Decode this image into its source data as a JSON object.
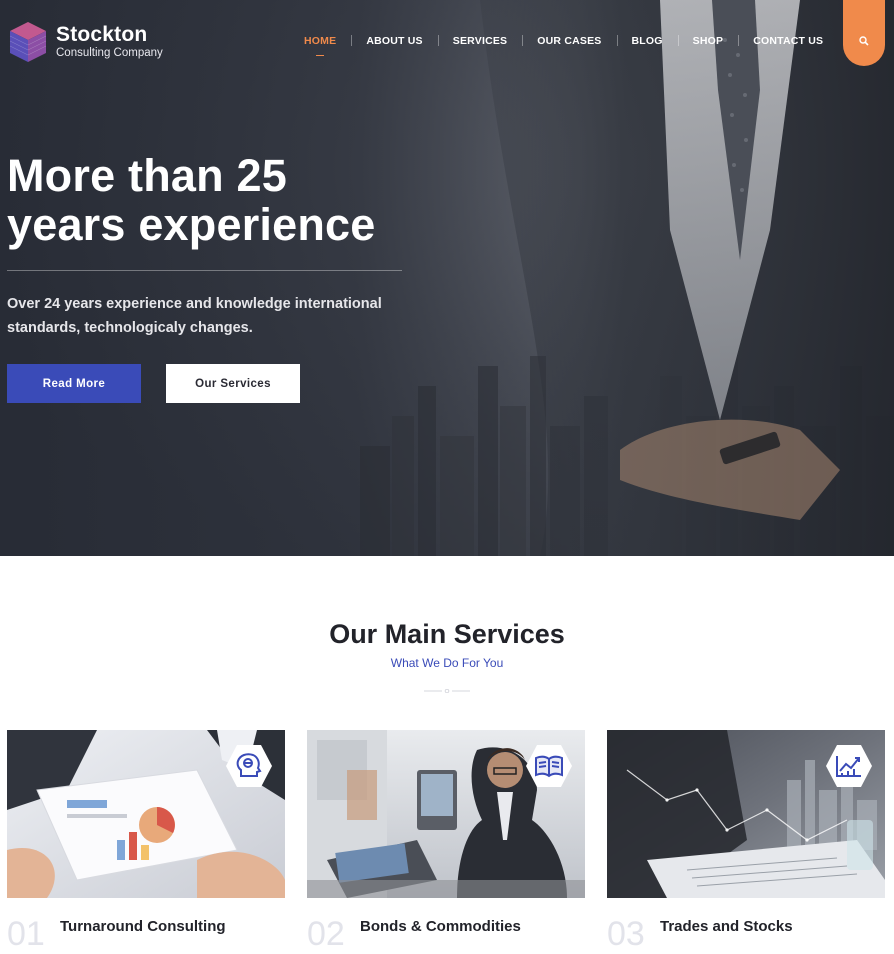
{
  "brand": {
    "name": "Stockton",
    "tagline": "Consulting Company",
    "logo_icon": "cube-logo-icon"
  },
  "nav": {
    "items": [
      {
        "label": "HOME",
        "active": true
      },
      {
        "label": "ABOUT US",
        "active": false
      },
      {
        "label": "SERVICES",
        "active": false
      },
      {
        "label": "OUR CASES",
        "active": false
      },
      {
        "label": "BLOG",
        "active": false
      },
      {
        "label": "SHOP",
        "active": false
      },
      {
        "label": "CONTACT US",
        "active": false
      }
    ],
    "search_icon": "search-icon"
  },
  "hero": {
    "title_line1": "More than 25",
    "title_line2": "years experience",
    "subtitle": "Over 24 years experience and knowledge international standards, technologicaly changes.",
    "primary_button": "Read More",
    "secondary_button": "Our Services"
  },
  "services": {
    "heading": "Our Main Services",
    "subheading": "What We Do For You",
    "cards": [
      {
        "number": "01",
        "title": "Turnaround Consulting",
        "icon": "consulting-head-icon"
      },
      {
        "number": "02",
        "title": "Bonds & Commodities",
        "icon": "open-book-icon"
      },
      {
        "number": "03",
        "title": "Trades and Stocks",
        "icon": "chart-up-icon"
      }
    ]
  },
  "colors": {
    "accent_orange": "#f08a4b",
    "primary_blue": "#3a4bb8",
    "text_dark": "#22232a"
  }
}
